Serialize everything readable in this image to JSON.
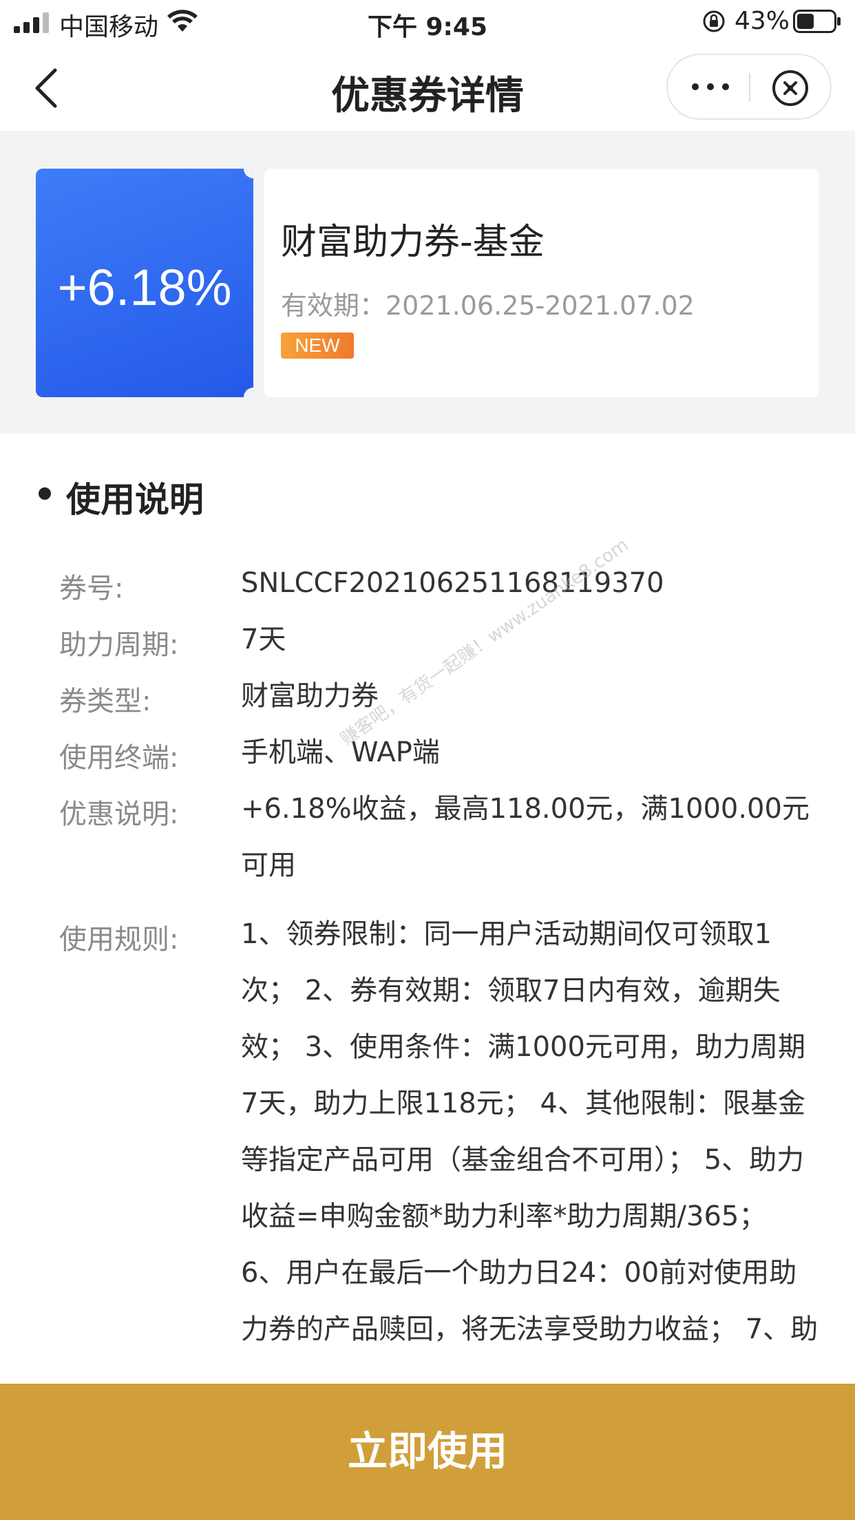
{
  "status_bar": {
    "carrier": "中国移动",
    "time": "下午 9:45",
    "battery": "43%"
  },
  "nav": {
    "title": "优惠券详情"
  },
  "coupon": {
    "rate": "+6.18%",
    "name": "财富助力券-基金",
    "validity": "有效期：2021.06.25-2021.07.02",
    "badge": "NEW"
  },
  "instructions": {
    "heading": "使用说明",
    "rows": [
      {
        "label": "券号:",
        "value": "SNLCCF2021062511681193​70"
      },
      {
        "label": "助力周期:",
        "value": "7天"
      },
      {
        "label": "券类型:",
        "value": "财富助力券"
      },
      {
        "label": "使用终端:",
        "value": "手机端、WAP端"
      },
      {
        "label": "优惠说明:",
        "value": "+6.18%收益，最高118.00元，满1000.00元可用"
      },
      {
        "label": "使用规则:",
        "value": "1、领券限制：同一用户活动期间仅可领取1次； 2、券有效期：领取7日内有效，逾期失效； 3、使用条件：满1000元可用，助力周期7天，助力上限118元； 4、其他限制：限基金等指定产品可用（基金组合不可用）； 5、助力收益=申购金额*助力利率*助力周期/365； 6、用户在最后一个助力日24：00前对使用助力券的产品赎回，将无法享受助力收益； 7、助"
      }
    ]
  },
  "watermark": "赚客吧，有货一起赚！www.zuanke8.com",
  "button": {
    "label": "立即使用"
  },
  "colors": {
    "coupon_blue": "#2f6af0",
    "button_gold": "#d09f3a",
    "badge_orange": "#f28a2f"
  }
}
